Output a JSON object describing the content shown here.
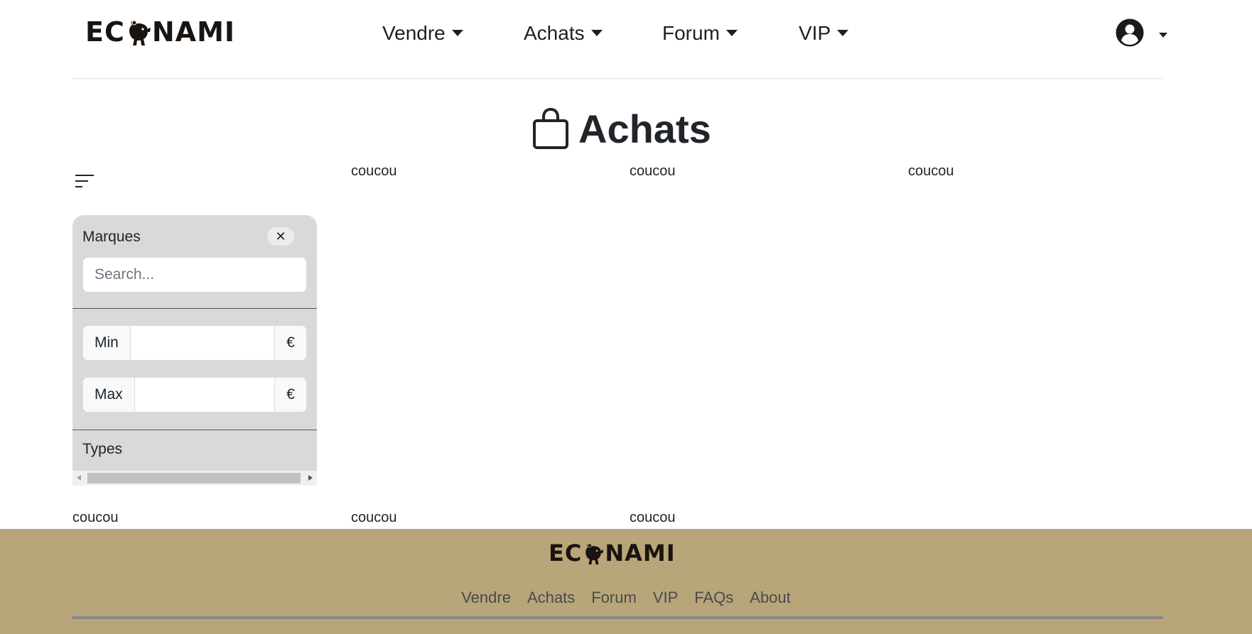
{
  "brand": {
    "logo_left": "EC",
    "logo_right": "NAMI"
  },
  "nav": {
    "items": [
      {
        "label": "Vendre"
      },
      {
        "label": "Achats"
      },
      {
        "label": "Forum"
      },
      {
        "label": "VIP"
      }
    ]
  },
  "user_menu": {
    "icon": "user-circle-icon"
  },
  "page": {
    "title": "Achats",
    "title_icon": "shopping-bag-icon"
  },
  "filter_toggle": {
    "icon": "filter-lines-icon"
  },
  "sidebar": {
    "brands_label": "Marques",
    "close_label": "✕",
    "search_placeholder": "Search...",
    "price_min_label": "Min",
    "price_max_label": "Max",
    "currency": "€",
    "types_label": "Types"
  },
  "grid": {
    "top_row": [
      "coucou",
      "coucou",
      "coucou"
    ],
    "bottom_row": [
      "coucou",
      "coucou",
      "coucou"
    ]
  },
  "footer": {
    "links": [
      "Vendre",
      "Achats",
      "Forum",
      "VIP",
      "FAQs",
      "About"
    ]
  },
  "colors": {
    "footer_bg": "#b8a67a",
    "sidebar_bg": "#d9d9d9",
    "text": "#212529"
  }
}
